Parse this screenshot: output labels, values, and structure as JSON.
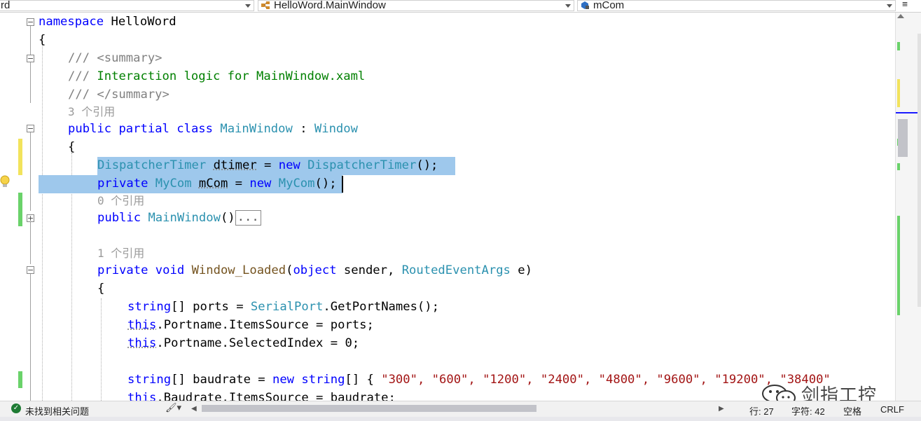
{
  "navbar": {
    "project_dropdown": "rd",
    "class_dropdown": "HelloWord.MainWindow",
    "member_dropdown": "mCom",
    "split_button": "≡"
  },
  "code": {
    "l1_kw": "namespace",
    "l1_name": " HelloWord",
    "l2": "{",
    "l3": "/// <summary>",
    "l4_prefix": "/// ",
    "l4_text": "Interaction logic for MainWindow.xaml",
    "l5": "/// </summary>",
    "refs_class": "3 个引用",
    "l6_kw1": "public",
    "l6_kw2": "partial",
    "l6_kw3": "class",
    "l6_name": "MainWindow",
    "l6_colon": " : ",
    "l6_base": "Window",
    "l7": "{",
    "l8_type": "DispatcherTimer",
    "l8_var": "dtimer",
    "l8_eq": " = ",
    "l8_new": "new",
    "l8_type2": "DispatcherTimer",
    "l8_end": "();",
    "l9_kw": "private",
    "l9_type": "MyCom",
    "l9_var": "mCom",
    "l9_eq": " = ",
    "l9_new": "new",
    "l9_type2": "MyCom",
    "l9_end": "();",
    "refs_ctor": "0 个引用",
    "l10_kw": "public",
    "l10_name": "MainWindow",
    "l10_parens": "()",
    "l10_fold": "...",
    "refs_loaded": "1 个引用",
    "l11_kw1": "private",
    "l11_kw2": "void",
    "l11_name": "Window_Loaded",
    "l11_p1": "(",
    "l11_kw3": "object",
    "l11_p2": " sender, ",
    "l11_type": "RoutedEventArgs",
    "l11_p3": " e)",
    "l12": "{",
    "l13_kw": "string",
    "l13_rest1": "[] ports = ",
    "l13_type": "SerialPort",
    "l13_rest2": ".GetPortNames();",
    "l14_this": "this",
    "l14_rest": ".Portname.ItemsSource = ports;",
    "l15_this": "this",
    "l15_rest": ".Portname.SelectedIndex = 0;",
    "l16_kw": "string",
    "l16_rest1": "[] baudrate = ",
    "l16_new": "new",
    "l16_kw2": "string",
    "l16_rest2": "[] { ",
    "l16_strs": "\"300\", \"600\", \"1200\", \"2400\", \"4800\", \"9600\", \"19200\", \"38400\"",
    "l17_this": "this",
    "l17_rest": ".Baudrate.ItemsSource = baudrate;"
  },
  "status": {
    "issues": "未找到相关问题",
    "line": "行: 27",
    "char": "字符: 42",
    "spaces": "空格",
    "eol": "CRLF"
  },
  "watermark": {
    "text": "剑指工控"
  },
  "colors": {
    "keyword": "#0000ff",
    "type": "#2b91af",
    "comment": "#008000",
    "string": "#a31515",
    "selection": "#9ec8ec",
    "change_saved": "#6ad26a",
    "change_unsaved": "#f2e35c"
  }
}
